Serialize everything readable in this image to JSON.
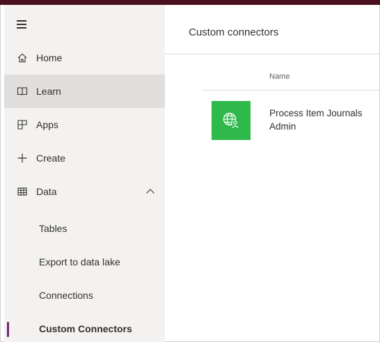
{
  "sidebar": {
    "items": [
      {
        "label": "Home",
        "icon": "home-icon"
      },
      {
        "label": "Learn",
        "icon": "book-icon",
        "active": true
      },
      {
        "label": "Apps",
        "icon": "apps-icon"
      },
      {
        "label": "Create",
        "icon": "plus-icon"
      },
      {
        "label": "Data",
        "icon": "table-icon",
        "expanded": true
      }
    ],
    "sub_items": [
      {
        "label": "Tables"
      },
      {
        "label": "Export to data lake"
      },
      {
        "label": "Connections"
      },
      {
        "label": "Custom Connectors",
        "selected": true
      }
    ]
  },
  "main": {
    "title": "Custom connectors",
    "table": {
      "columns": [
        "Name"
      ],
      "rows": [
        {
          "name": "Process Item Journals Admin",
          "icon": "globe-person-icon"
        }
      ]
    }
  },
  "colors": {
    "accent": "#742774",
    "connector_tile": "#2fb94a",
    "sidebar_bg": "#f3f2f1",
    "active_bg": "#e1dfdd",
    "top_bar": "#4a1020"
  }
}
